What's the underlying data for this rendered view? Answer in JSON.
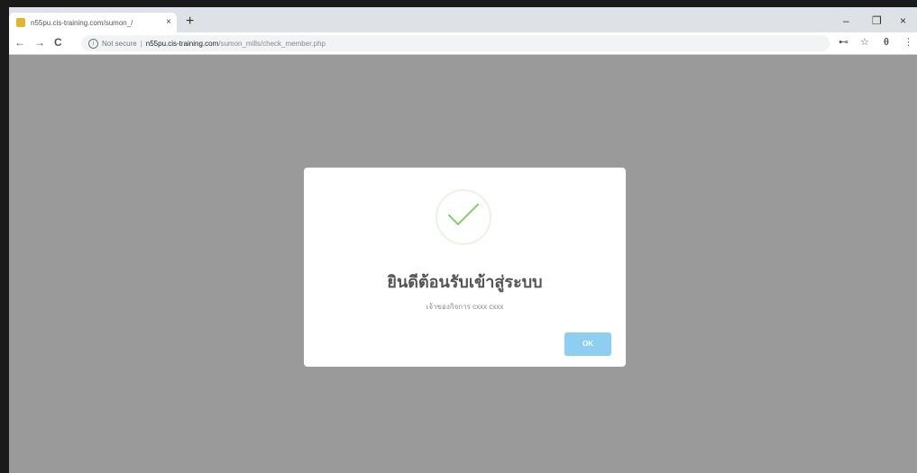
{
  "browser": {
    "tab_title": "n55pu.cis-training.com/sumon_/",
    "tab_close": "×",
    "new_tab": "+",
    "window_controls": {
      "minimize": "–",
      "restore": "❐",
      "close": "×"
    },
    "nav": {
      "back": "←",
      "forward": "→",
      "reload": "C"
    },
    "address": {
      "info_icon": "i",
      "security_label": "Not secure",
      "separator": "|",
      "host": "n55pu.cis-training.com",
      "path": "/sumon_mills/check_member.php"
    },
    "toolbar_icons": {
      "key": "⊷",
      "star": "☆",
      "account": "θ",
      "menu": "⋮"
    }
  },
  "dialog": {
    "icon": "success-check-icon",
    "title": "ยินดีต้อนรับเข้าสู่ระบบ",
    "message": "เจ้าของกิจการ cxxx cxxx",
    "ok_label": "OK",
    "colors": {
      "ok_button": "#8ccff0",
      "check": "#8bd06d",
      "overlay": "#9a9a9a"
    }
  }
}
